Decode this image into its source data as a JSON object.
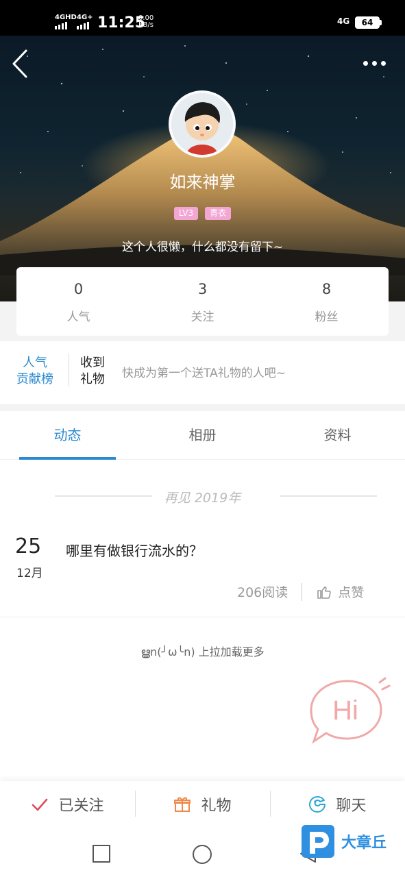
{
  "status_bar": {
    "network1": "4GHD",
    "network2": "4G+",
    "time": "11:25",
    "speed_value": "0.00",
    "speed_unit": "KB/s",
    "network3": "4G",
    "battery": "64"
  },
  "profile": {
    "username": "如来神掌",
    "tags": [
      "LV3",
      "青衣"
    ],
    "bio": "这个人很懒，什么都没有留下~"
  },
  "stats": [
    {
      "value": "0",
      "label": "人气"
    },
    {
      "value": "3",
      "label": "关注"
    },
    {
      "value": "8",
      "label": "粉丝"
    }
  ],
  "gifts": {
    "rank_line1": "人气",
    "rank_line2": "贡献榜",
    "label_line1": "收到",
    "label_line2": "礼物",
    "hint": "快成为第一个送TA礼物的人吧~"
  },
  "tabs": [
    {
      "label": "动态",
      "active": true
    },
    {
      "label": "相册",
      "active": false
    },
    {
      "label": "资料",
      "active": false
    }
  ],
  "feed": {
    "year_divider": "再见 2019年",
    "post": {
      "day": "25",
      "month": "12月",
      "title": "哪里有做银行流水的？",
      "reads": "206阅读",
      "like_label": "点赞"
    },
    "load_more": "ൠn(╯ω╰n) 上拉加载更多"
  },
  "hi_bubble": "Hi",
  "actions": [
    {
      "label": "已关注",
      "icon": "check-icon",
      "color": "#e0485a"
    },
    {
      "label": "礼物",
      "icon": "gift-icon",
      "color": "#f08a4b"
    },
    {
      "label": "聊天",
      "icon": "chat-icon",
      "color": "#2aa6d8"
    }
  ],
  "watermark": "大章丘",
  "colors": {
    "accent": "#2a8ad0",
    "tag_pink": "#f3a6d3",
    "hi_pink": "#f0a8a8"
  }
}
